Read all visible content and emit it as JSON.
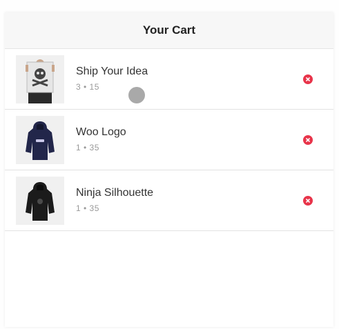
{
  "header": {
    "title": "Your Cart"
  },
  "cart": {
    "items": [
      {
        "name": "Ship Your Idea",
        "meta": "3 • 15",
        "icon": "poster-thumbnail",
        "remove_icon": "remove-icon"
      },
      {
        "name": "Woo Logo",
        "meta": "1 • 35",
        "icon": "hoodie-thumbnail",
        "remove_icon": "remove-icon"
      },
      {
        "name": "Ninja Silhouette",
        "meta": "1 • 35",
        "icon": "hoodie-thumbnail",
        "remove_icon": "remove-icon"
      }
    ]
  },
  "colors": {
    "accent_remove": "#e8344a",
    "header_bg": "#f7f7f7",
    "text_primary": "#333333",
    "text_secondary": "#999999"
  }
}
